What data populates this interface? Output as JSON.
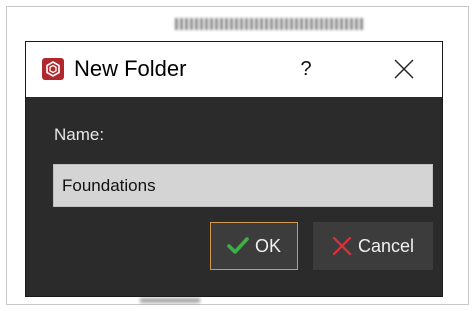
{
  "dialog": {
    "title": "New Folder",
    "app_icon": "app-logo-icon",
    "help_label": "?",
    "close_icon": "close-icon"
  },
  "form": {
    "name_label": "Name:",
    "name_value": "Foundations"
  },
  "buttons": {
    "ok_label": "OK",
    "ok_icon": "checkmark-icon",
    "cancel_label": "Cancel",
    "cancel_icon": "x-mark-icon"
  },
  "colors": {
    "app_icon_bg": "#b0282c",
    "dialog_bg": "#2b2b2b",
    "ok_border": "#d59a49",
    "check_green": "#3cb043",
    "cancel_red": "#e0303a"
  }
}
